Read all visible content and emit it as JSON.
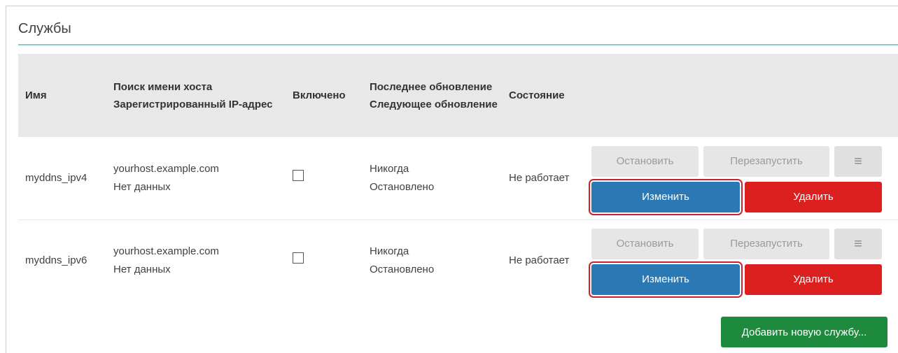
{
  "section": {
    "title": "Службы"
  },
  "table": {
    "headers": {
      "name": "Имя",
      "hostname_line1": "Поиск имени хоста",
      "hostname_line2": "Зарегистрированный IP-адрес",
      "enabled": "Включено",
      "update_line1": "Последнее обновление",
      "update_line2": "Следующее обновление",
      "status": "Состояние"
    },
    "rows": [
      {
        "name": "myddns_ipv4",
        "hostname": "yourhost.example.com",
        "registered_ip": "Нет данных",
        "enabled": false,
        "last_update": "Никогда",
        "next_update": "Остановлено",
        "status": "Не работает"
      },
      {
        "name": "myddns_ipv6",
        "hostname": "yourhost.example.com",
        "registered_ip": "Нет данных",
        "enabled": false,
        "last_update": "Никогда",
        "next_update": "Остановлено",
        "status": "Не работает"
      }
    ]
  },
  "actions": {
    "stop": "Остановить",
    "restart": "Перезапустить",
    "menu_icon": "≡",
    "edit": "Изменить",
    "delete": "Удалить"
  },
  "add_button": "Добавить новую службу...",
  "colors": {
    "edit": "#2a78b4",
    "delete": "#dc1f1f",
    "add": "#1e8a3d",
    "highlight": "#cc1f2f",
    "title_rule": "#8fc8c4"
  }
}
